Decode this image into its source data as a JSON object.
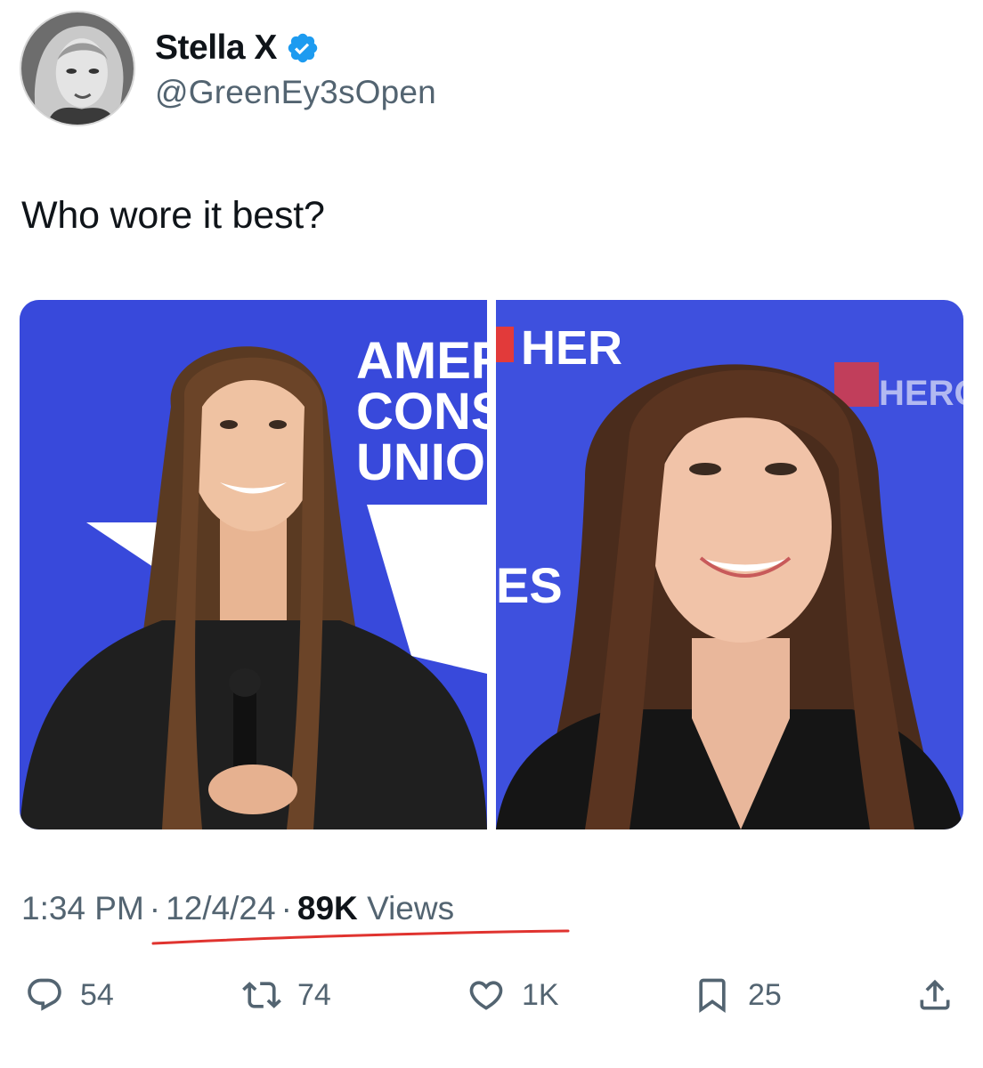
{
  "author": {
    "display_name": "Stella X",
    "handle": "@GreenEy3sOpen",
    "verified_icon": "verified-badge-icon"
  },
  "tweet": {
    "text": "Who wore it best?"
  },
  "media": [
    {
      "name": "photo-left",
      "sign_text_lines": [
        "AMER",
        "CONS",
        "UNIO"
      ]
    },
    {
      "name": "photo-right",
      "sign_text_lines": [
        "HER",
        "HERO",
        "ES"
      ]
    }
  ],
  "meta": {
    "time": "1:34 PM",
    "date": "12/4/24",
    "views_count": "89K",
    "views_label": "Views",
    "separator": "·"
  },
  "actions": {
    "replies": {
      "icon": "reply-icon",
      "count": "54"
    },
    "retweets": {
      "icon": "retweet-icon",
      "count": "74"
    },
    "likes": {
      "icon": "heart-icon",
      "count": "1K"
    },
    "bookmarks": {
      "icon": "bookmark-icon",
      "count": "25"
    },
    "share": {
      "icon": "share-icon"
    }
  },
  "colors": {
    "verified_blue": "#1d9bf0",
    "underline_red": "#e0332f",
    "muted_text": "#536471",
    "primary_text": "#0f1419",
    "stage_blue": "#3b4ce0"
  }
}
